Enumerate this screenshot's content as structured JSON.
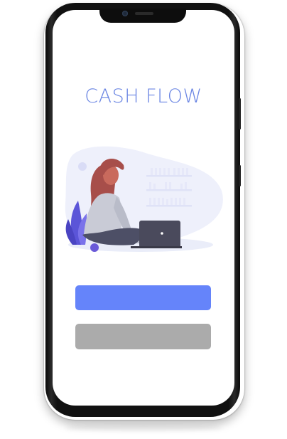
{
  "app": {
    "title": "CASH FLOW"
  },
  "buttons": {
    "primary_label": "",
    "secondary_label": ""
  },
  "colors": {
    "accent": "#6b86e3",
    "primary_button": "#6584fa",
    "secondary_button": "#ababab",
    "phone_frame": "#111111"
  },
  "illustration": {
    "subject": "woman-with-laptop-illustration"
  }
}
